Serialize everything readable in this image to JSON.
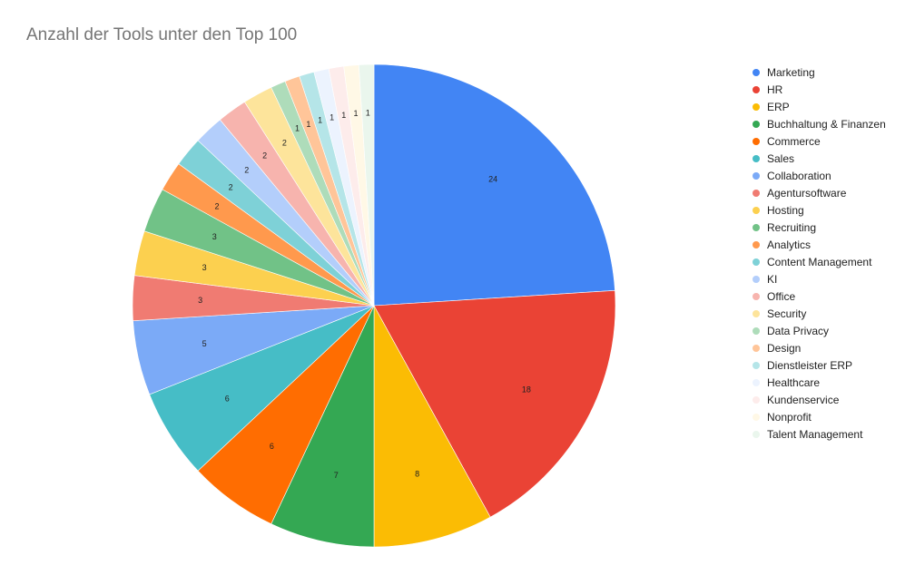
{
  "chart_data": {
    "type": "pie",
    "title": "Anzahl der Tools unter den Top 100",
    "legend_position": "right",
    "start_angle": "12 o'clock, clockwise",
    "slices": [
      {
        "label": "Marketing",
        "value": 24,
        "color": "#4285f4"
      },
      {
        "label": "HR",
        "value": 18,
        "color": "#ea4335"
      },
      {
        "label": "ERP",
        "value": 8,
        "color": "#fbbc04"
      },
      {
        "label": "Buchhaltung & Finanzen",
        "value": 7,
        "color": "#34a853"
      },
      {
        "label": "Commerce",
        "value": 6,
        "color": "#ff6d01"
      },
      {
        "label": "Sales",
        "value": 6,
        "color": "#46bdc6"
      },
      {
        "label": "Collaboration",
        "value": 5,
        "color": "#7baaf7"
      },
      {
        "label": "Agentursoftware",
        "value": 3,
        "color": "#f07b72"
      },
      {
        "label": "Hosting",
        "value": 3,
        "color": "#fcd04f"
      },
      {
        "label": "Recruiting",
        "value": 3,
        "color": "#71c287"
      },
      {
        "label": "Analytics",
        "value": 2,
        "color": "#ff994d"
      },
      {
        "label": "Content Management",
        "value": 2,
        "color": "#7ed1d7"
      },
      {
        "label": "KI",
        "value": 2,
        "color": "#b3cefb"
      },
      {
        "label": "Office",
        "value": 2,
        "color": "#f7b4ae"
      },
      {
        "label": "Security",
        "value": 2,
        "color": "#fde49b"
      },
      {
        "label": "Data Privacy",
        "value": 1,
        "color": "#aedcba"
      },
      {
        "label": "Design",
        "value": 1,
        "color": "#ffc599"
      },
      {
        "label": "Dienstleister ERP",
        "value": 1,
        "color": "#b5e5e8"
      },
      {
        "label": "Healthcare",
        "value": 1,
        "color": "#ecf3fe"
      },
      {
        "label": "Kundenservice",
        "value": 1,
        "color": "#fdeceb"
      },
      {
        "label": "Nonprofit",
        "value": 1,
        "color": "#fff8e6"
      },
      {
        "label": "Talent Management",
        "value": 1,
        "color": "#eaf6ed"
      }
    ]
  }
}
